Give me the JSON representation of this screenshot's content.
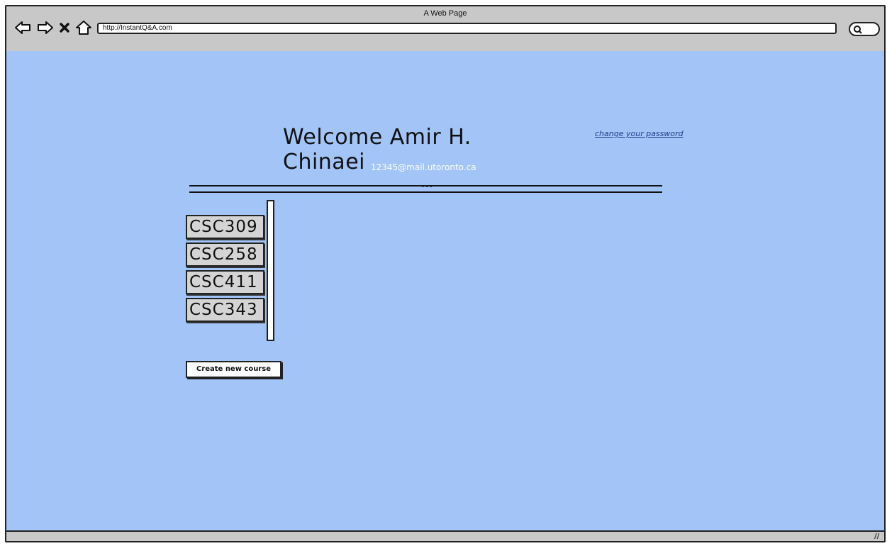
{
  "window": {
    "title": "A Web Page"
  },
  "browser": {
    "url": "http://InstantQ&A.com"
  },
  "header": {
    "welcome": "Welcome Amir H. Chinaei",
    "change_password": "change your password",
    "email": "12345@mail.utoronto.ca"
  },
  "divider": {
    "dots": "•••"
  },
  "courses": [
    {
      "code": "CSC309"
    },
    {
      "code": "CSC258"
    },
    {
      "code": "CSC411"
    },
    {
      "code": "CSC343"
    }
  ],
  "actions": {
    "create_course": "Create new course"
  },
  "icons": {
    "back": "arrow-left-icon",
    "forward": "arrow-right-icon",
    "stop": "close-icon",
    "home": "home-icon",
    "search": "search-icon",
    "resize": "resize-grip-icon"
  },
  "colors": {
    "content_bg": "#a2c4f7",
    "link": "#1d3d8a",
    "email": "#ffffff"
  }
}
